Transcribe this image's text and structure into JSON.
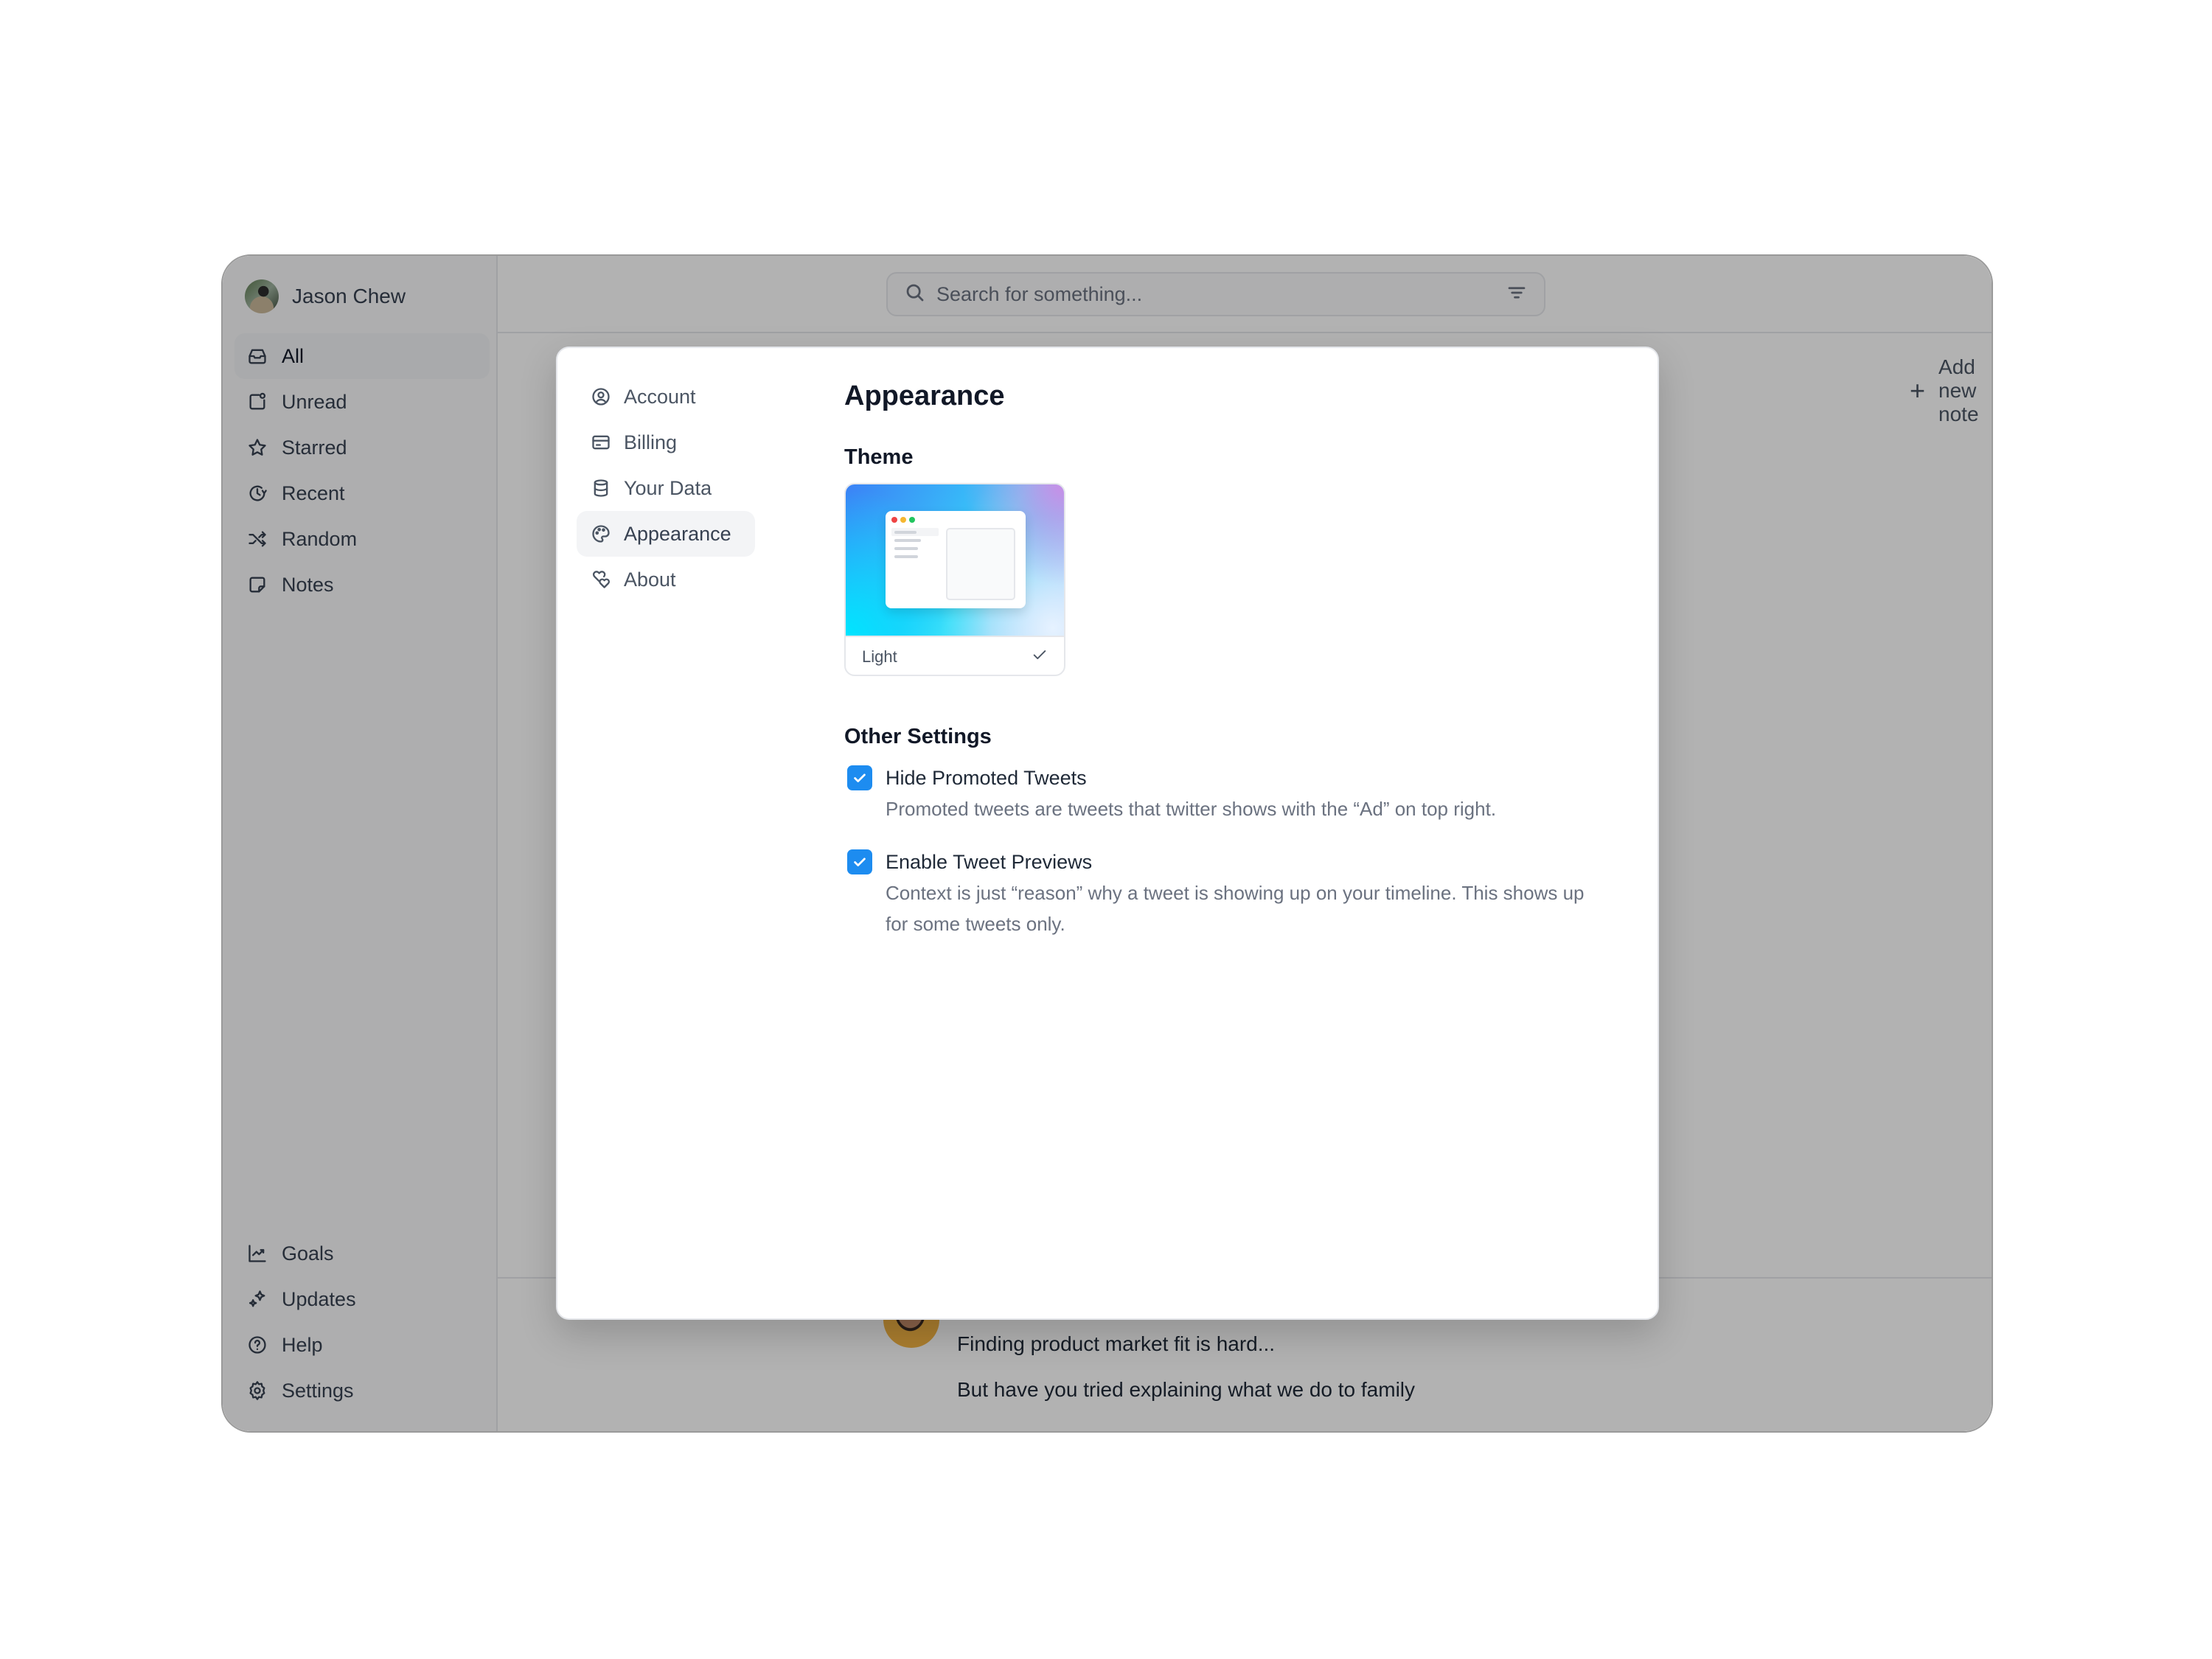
{
  "user": {
    "name": "Jason Chew"
  },
  "sidebar": {
    "items": [
      {
        "label": "All",
        "icon": "inbox-icon",
        "active": true
      },
      {
        "label": "Unread",
        "icon": "unread-icon"
      },
      {
        "label": "Starred",
        "icon": "star-icon"
      },
      {
        "label": "Recent",
        "icon": "recent-clock-icon"
      },
      {
        "label": "Random",
        "icon": "shuffle-icon"
      },
      {
        "label": "Notes",
        "icon": "note-icon"
      }
    ],
    "bottom_items": [
      {
        "label": "Goals",
        "icon": "chart-line-icon"
      },
      {
        "label": "Updates",
        "icon": "sparkles-icon"
      },
      {
        "label": "Help",
        "icon": "help-circle-icon"
      },
      {
        "label": "Settings",
        "icon": "gear-icon"
      }
    ]
  },
  "search": {
    "placeholder": "Search for something..."
  },
  "main": {
    "add_note_label": "Add new note",
    "tweet": {
      "lines": [
        "Finding product market fit is hard...",
        "But have you tried explaining what we do to family"
      ]
    }
  },
  "settings_modal": {
    "nav": [
      {
        "label": "Account",
        "icon": "user-circle-icon"
      },
      {
        "label": "Billing",
        "icon": "credit-card-icon"
      },
      {
        "label": "Your Data",
        "icon": "database-icon"
      },
      {
        "label": "Appearance",
        "icon": "palette-icon",
        "active": true
      },
      {
        "label": "About",
        "icon": "hearts-icon"
      }
    ],
    "title": "Appearance",
    "theme_section": "Theme",
    "theme_option": {
      "label": "Light",
      "selected": true
    },
    "other_section": "Other Settings",
    "settings": [
      {
        "label": "Hide Promoted Tweets",
        "description": "Promoted tweets are tweets that twitter shows with the “Ad” on top right.",
        "checked": true
      },
      {
        "label": "Enable Tweet Previews",
        "description": "Context is just “reason” why a tweet is showing up on your timeline. This shows up for some tweets only.",
        "checked": true
      }
    ]
  },
  "colors": {
    "accent": "#1d8cf0",
    "overlay": "rgba(0,0,0,0.30)"
  }
}
